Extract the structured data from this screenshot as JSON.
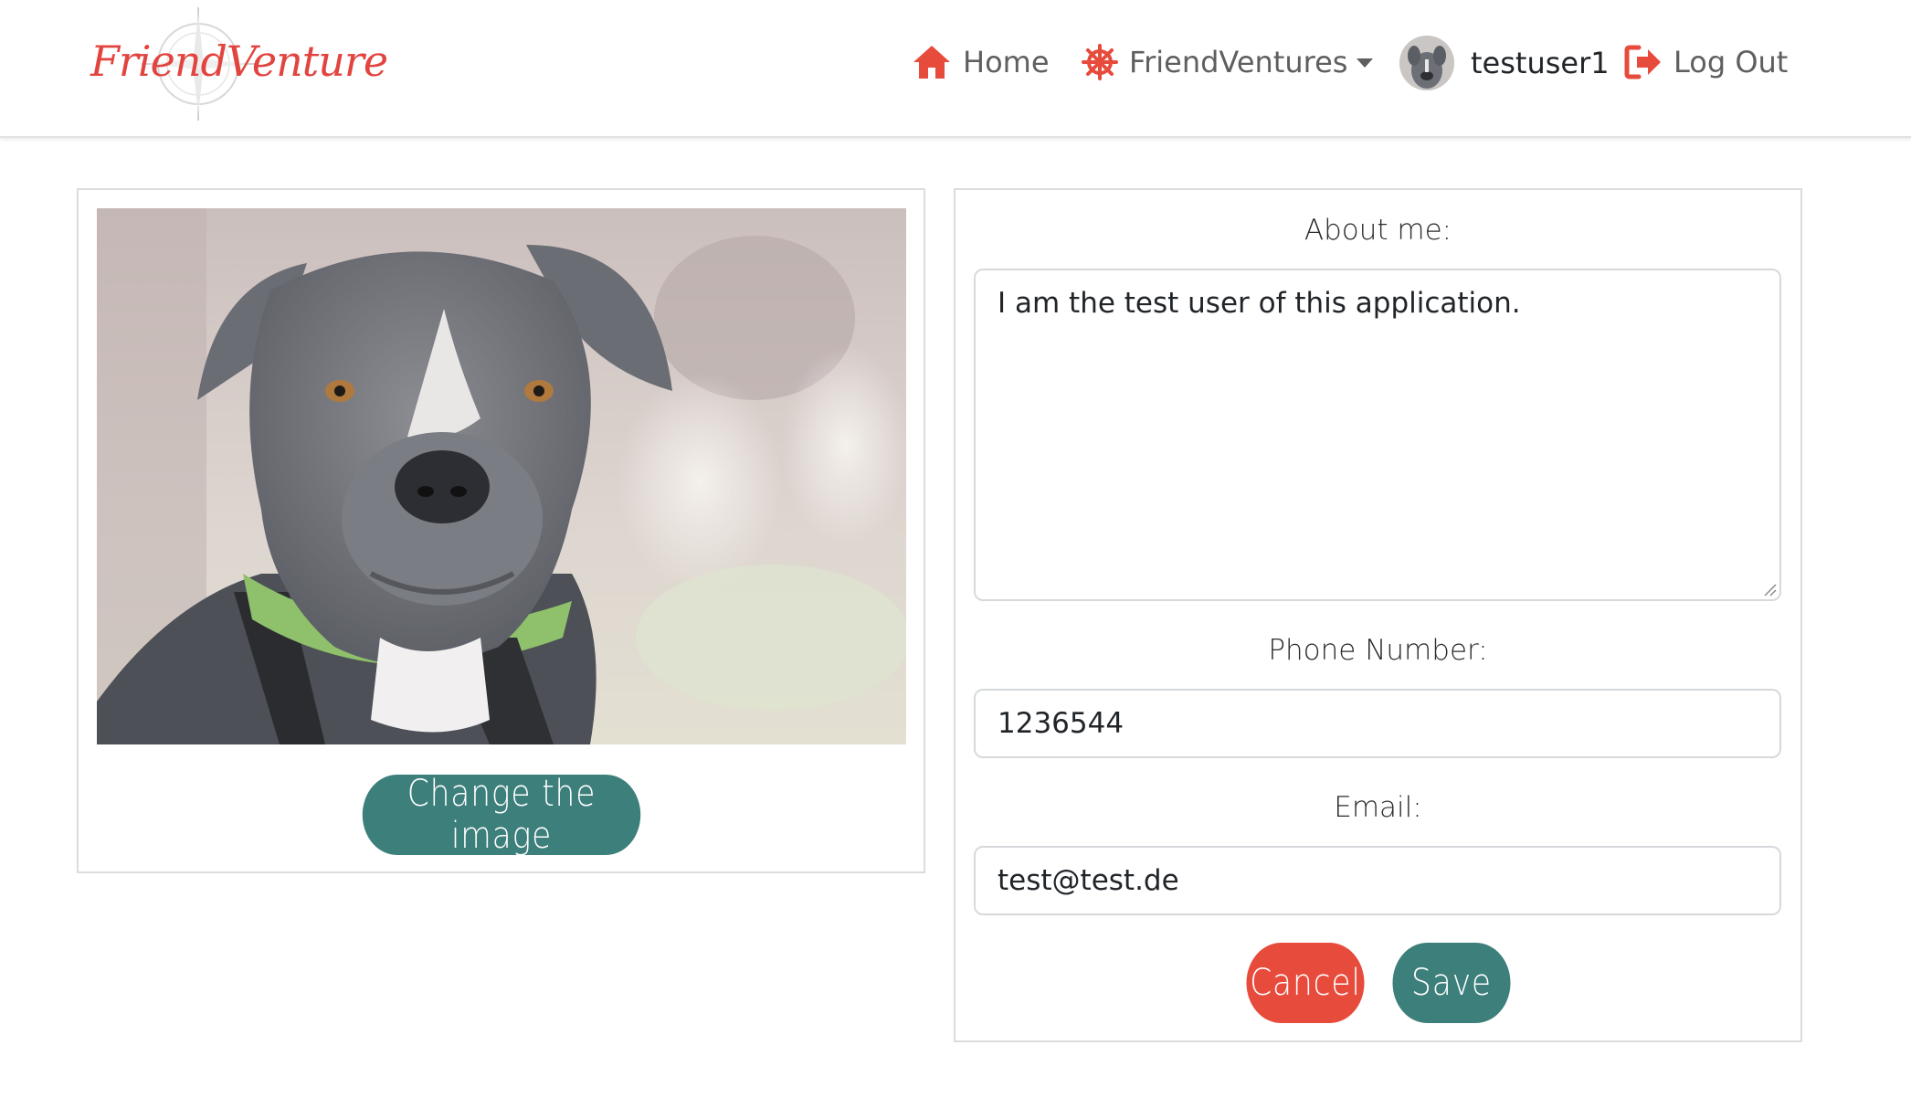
{
  "brand": {
    "name": "FriendVenture",
    "color": "#e2443f"
  },
  "nav": {
    "home": {
      "label": "Home",
      "icon": "home-icon"
    },
    "friendventures": {
      "label": "FriendVentures",
      "icon": "ship-wheel-icon"
    },
    "user": {
      "label": "testuser1",
      "icon": "avatar"
    },
    "logout": {
      "label": "Log Out",
      "icon": "sign-out-icon"
    }
  },
  "profile": {
    "image_alt": "Profile photo of a grey dog",
    "change_image_label": "Change the image",
    "about_label": "About me:",
    "about_value": "I am the test user of this application.",
    "phone_label": "Phone Number:",
    "phone_value": "1236544",
    "email_label": "Email:",
    "email_value": "test@test.de",
    "cancel_label": "Cancel",
    "save_label": "Save"
  },
  "colors": {
    "accent_red": "#e74b3c",
    "accent_teal": "#3d7f7b",
    "nav_text": "#5f5f5f"
  }
}
